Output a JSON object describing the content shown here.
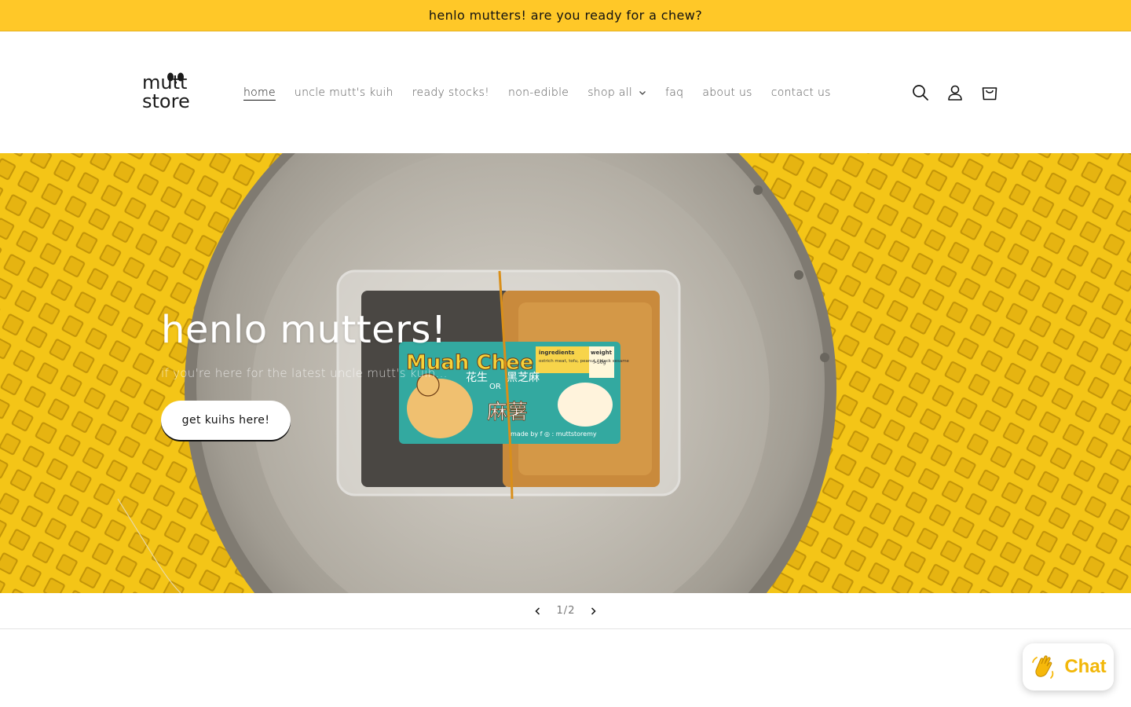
{
  "announcement": {
    "text": "henlo mutters! are you ready for a chew?"
  },
  "header": {
    "logo": {
      "line1": "mutt",
      "line2": "store"
    },
    "nav": [
      {
        "label": "home",
        "active": true
      },
      {
        "label": "uncle mutt's kuih"
      },
      {
        "label": "ready stocks!"
      },
      {
        "label": "non-edible"
      },
      {
        "label": "shop all",
        "has_dropdown": true
      },
      {
        "label": "faq"
      },
      {
        "label": "about us"
      },
      {
        "label": "contact us"
      }
    ],
    "icons": [
      "search-icon",
      "account-icon",
      "cart-icon"
    ]
  },
  "hero": {
    "title": "henlo mutters!",
    "subtitle": "if you're here for the latest uncle mutt's kuih...",
    "button_label": "get kuihs here!",
    "package_label": {
      "brand": "Muah Chee",
      "ingredients_title": "ingredients",
      "ingredients": "ostrich meat, tofu, peanut / black sesame",
      "weight_title": "weight",
      "weight": ">50g",
      "chinese_1": "花生",
      "chinese_or": "OR",
      "chinese_2": "黑芝麻",
      "chinese_big": "麻薯",
      "footer": "made by  f ◎ : muttstoremy"
    }
  },
  "slider": {
    "current": "1",
    "separator": "/",
    "total": "2"
  },
  "chat": {
    "label": "Chat"
  },
  "colors": {
    "announcement_bg": "#ffc828",
    "chat_text": "#f2b709",
    "hero_bg": "#f2c218"
  }
}
